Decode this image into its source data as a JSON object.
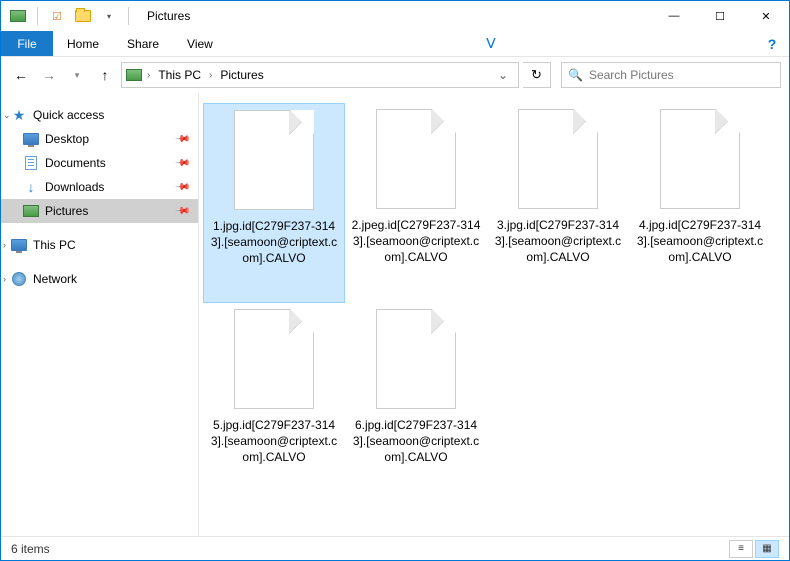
{
  "titlebar": {
    "title": "Pictures"
  },
  "window_controls": {
    "min": "—",
    "max": "☐",
    "close": "✕"
  },
  "menubar": {
    "file": "File",
    "home": "Home",
    "share": "Share",
    "view": "View"
  },
  "breadcrumb": {
    "seg1": "This PC",
    "seg2": "Pictures"
  },
  "search": {
    "placeholder": "Search Pictures"
  },
  "sidebar": {
    "quick_access": "Quick access",
    "items": [
      {
        "label": "Desktop"
      },
      {
        "label": "Documents"
      },
      {
        "label": "Downloads"
      },
      {
        "label": "Pictures"
      }
    ],
    "this_pc": "This PC",
    "network": "Network"
  },
  "files": [
    {
      "name": "1.jpg.id[C279F237-3143].[seamoon@criptext.com].CALVO",
      "selected": true
    },
    {
      "name": "2.jpeg.id[C279F237-3143].[seamoon@criptext.com].CALVO",
      "selected": false
    },
    {
      "name": "3.jpg.id[C279F237-3143].[seamoon@criptext.com].CALVO",
      "selected": false
    },
    {
      "name": "4.jpg.id[C279F237-3143].[seamoon@criptext.com].CALVO",
      "selected": false
    },
    {
      "name": "5.jpg.id[C279F237-3143].[seamoon@criptext.com].CALVO",
      "selected": false
    },
    {
      "name": "6.jpg.id[C279F237-3143].[seamoon@criptext.com].CALVO",
      "selected": false
    }
  ],
  "statusbar": {
    "count": "6 items"
  }
}
